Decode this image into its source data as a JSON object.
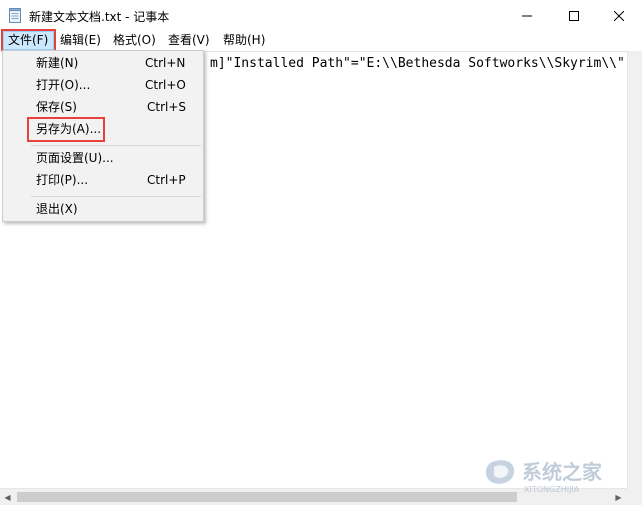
{
  "window": {
    "title": "新建文本文档.txt - 记事本",
    "controls": {
      "minimize_icon": "minimize-icon",
      "maximize_icon": "maximize-icon",
      "close_icon": "close-icon"
    }
  },
  "menubar": {
    "items": [
      {
        "label": "文件(F)",
        "active": true
      },
      {
        "label": "编辑(E)"
      },
      {
        "label": "格式(O)"
      },
      {
        "label": "查看(V)"
      },
      {
        "label": "帮助(H)"
      }
    ]
  },
  "file_menu": {
    "items": [
      {
        "label": "新建(N)",
        "shortcut": "Ctrl+N"
      },
      {
        "label": "打开(O)...",
        "shortcut": "Ctrl+O"
      },
      {
        "label": "保存(S)",
        "shortcut": "Ctrl+S"
      },
      {
        "label": "另存为(A)...",
        "shortcut": "",
        "highlighted": true
      },
      {
        "label": "页面设置(U)...",
        "shortcut": ""
      },
      {
        "label": "打印(P)...",
        "shortcut": "Ctrl+P"
      },
      {
        "label": "退出(X)",
        "shortcut": ""
      }
    ]
  },
  "editor": {
    "visible_text": "m]\"Installed Path\"=\"E:\\\\Bethesda Softworks\\\\Skyrim\\\\\""
  },
  "watermark": {
    "brand": "系统之家",
    "domain": "XITONGZHIJIA"
  },
  "colors": {
    "menu_active_bg": "#cce8ff",
    "menu_active_border": "#99d1ff",
    "annotation_red": "#e8413b",
    "dropdown_bg": "#f2f2f2"
  }
}
